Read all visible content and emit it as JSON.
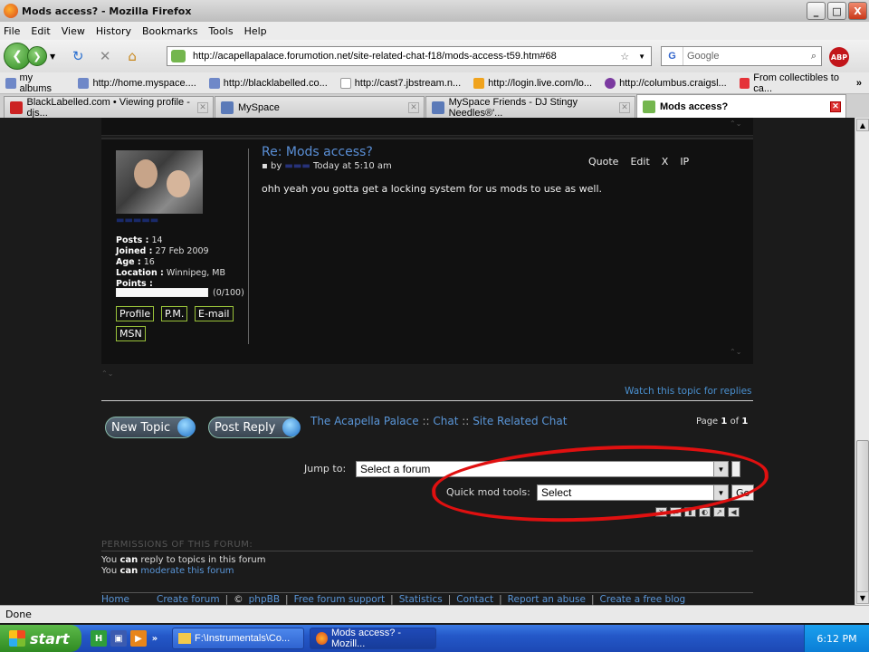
{
  "window": {
    "title": "Mods access? - Mozilla Firefox",
    "buttons": [
      "_",
      "□",
      "X"
    ]
  },
  "menu": [
    "File",
    "Edit",
    "View",
    "History",
    "Bookmarks",
    "Tools",
    "Help"
  ],
  "nav": {
    "url": "http://acapellapalace.forumotion.net/site-related-chat-f18/mods-access-t59.htm#68",
    "search_placeholder": "Google",
    "abp": "ABP"
  },
  "bookmarks": [
    "my albums",
    "http://home.myspace....",
    "http://blacklabelled.co...",
    "http://cast7.jbstream.n...",
    "http://login.live.com/lo...",
    "http://columbus.craigsl...",
    "From collectibles to ca..."
  ],
  "tabs": [
    {
      "label": "BlackLabelled.com • Viewing profile - djs..."
    },
    {
      "label": "MySpace"
    },
    {
      "label": "MySpace Friends - DJ Stingy Needles®'..."
    },
    {
      "label": "Mods access?"
    }
  ],
  "post": {
    "title": "Re: Mods access?",
    "by": "by",
    "time": "Today at 5:10 am",
    "actions": [
      "Quote",
      "Edit",
      "X",
      "IP"
    ],
    "body": "ohh yeah you gotta get a locking system for us mods to use as well.",
    "user": {
      "posts_label": "Posts :",
      "posts": "14",
      "joined_label": "Joined :",
      "joined": "27 Feb 2009",
      "age_label": "Age :",
      "age": "16",
      "location_label": "Location :",
      "location": "Winnipeg, MB",
      "points_label": "Points :",
      "points_text": "(0/100)",
      "points_fraction": 0
    },
    "buttons": [
      "Profile",
      "P.M.",
      "E-mail",
      "MSN"
    ]
  },
  "watch_link": "Watch this topic for replies",
  "actions": {
    "new_topic": "New Topic",
    "post_reply": "Post Reply"
  },
  "breadcrumb": [
    "The Acapella Palace",
    "Chat",
    "Site Related Chat"
  ],
  "breadcrumb_sep": "::",
  "pagination": {
    "label": "Page",
    "current": "1",
    "of": "of",
    "total": "1"
  },
  "jump": {
    "label": "Jump to:",
    "value": "Select a forum"
  },
  "quickmod": {
    "label": "Quick mod tools:",
    "value": "Select",
    "go": "Go"
  },
  "permissions": {
    "header": "PERMISSIONS OF THIS FORUM:",
    "line1_pre": "You",
    "line1_bold": "can",
    "line1_post": "reply to topics in this forum",
    "line2_pre": "You",
    "line2_bold": "can",
    "line2_link": "moderate this forum"
  },
  "footer": [
    "Home",
    "Create forum",
    "©",
    "phpBB",
    "Free forum support",
    "Statistics",
    "Contact",
    "Report an abuse",
    "Create a free blog"
  ],
  "status": "Done",
  "taskbar": {
    "start": "start",
    "tasks": [
      "F:\\Instrumentals\\Co...",
      "Mods access? - Mozill..."
    ],
    "clock": "6:12 PM"
  },
  "colors": {
    "link": "#5a96d8",
    "accent_oval": "#e01010",
    "page_bg": "#1b1b1b"
  }
}
